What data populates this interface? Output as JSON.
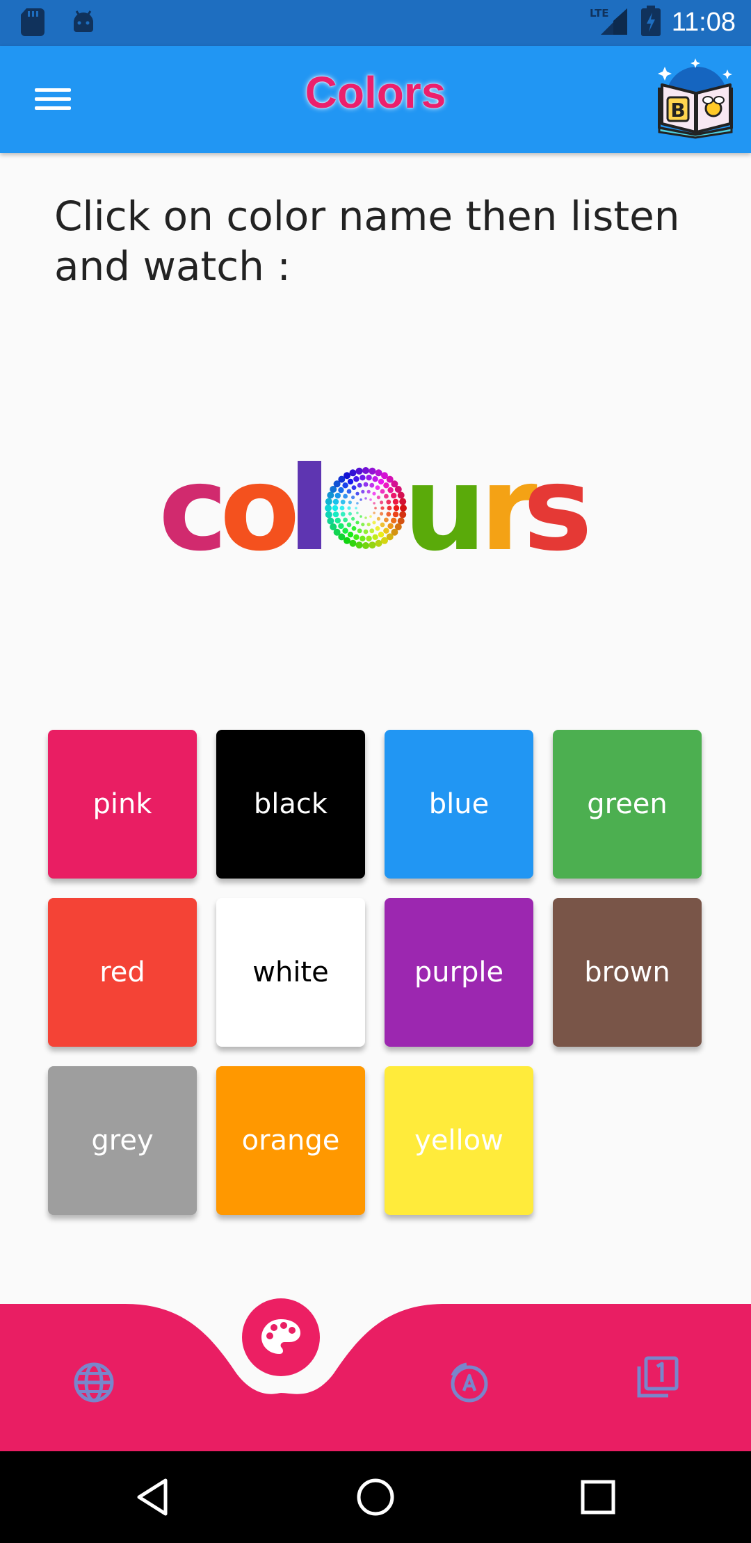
{
  "status_bar": {
    "time": "11:08",
    "network": "LTE",
    "icons": [
      "sd-card-icon",
      "android-icon",
      "lte-signal-icon",
      "battery-charging-icon"
    ]
  },
  "app_bar": {
    "title": "Colors",
    "menu_icon": "hamburger-menu-icon",
    "logo_icon": "book-logo-icon",
    "logo_letter": "B",
    "title_color": "#ec1f6c",
    "background": "#2196f3"
  },
  "instructions": "Click on color name then listen and watch :",
  "logo": {
    "word_colors": {
      "c": "#d12a6e",
      "o": "#f4511e",
      "l": "#5e35b1",
      "wheel": "color-wheel-icon",
      "u": "#5aaa0a",
      "r": "#f4a215",
      "s": "#e53935"
    }
  },
  "colors": [
    {
      "label": "pink",
      "bg": "#e91e63",
      "fg": "#ffffff"
    },
    {
      "label": "black",
      "bg": "#000000",
      "fg": "#ffffff"
    },
    {
      "label": "blue",
      "bg": "#2196f3",
      "fg": "#ffffff"
    },
    {
      "label": "green",
      "bg": "#4caf50",
      "fg": "#ffffff"
    },
    {
      "label": "red",
      "bg": "#f44336",
      "fg": "#ffffff"
    },
    {
      "label": "white",
      "bg": "#ffffff",
      "fg": "#000000"
    },
    {
      "label": "purple",
      "bg": "#9c27b0",
      "fg": "#ffffff"
    },
    {
      "label": "brown",
      "bg": "#795548",
      "fg": "#ffffff"
    },
    {
      "label": "grey",
      "bg": "#9e9e9e",
      "fg": "#ffffff"
    },
    {
      "label": "orange",
      "bg": "#ff9800",
      "fg": "#ffffff"
    },
    {
      "label": "yellow",
      "bg": "#ffeb3b",
      "fg": "#ffffff"
    }
  ],
  "bottom_nav": {
    "background": "#e91e63",
    "items": [
      {
        "icon": "globe-icon"
      },
      {
        "icon": "palette-icon",
        "active": true
      },
      {
        "icon": "alphabet-icon"
      },
      {
        "icon": "numbers-icon"
      }
    ]
  },
  "system_nav": {
    "icons": [
      "back-icon",
      "home-icon",
      "recents-icon"
    ]
  }
}
